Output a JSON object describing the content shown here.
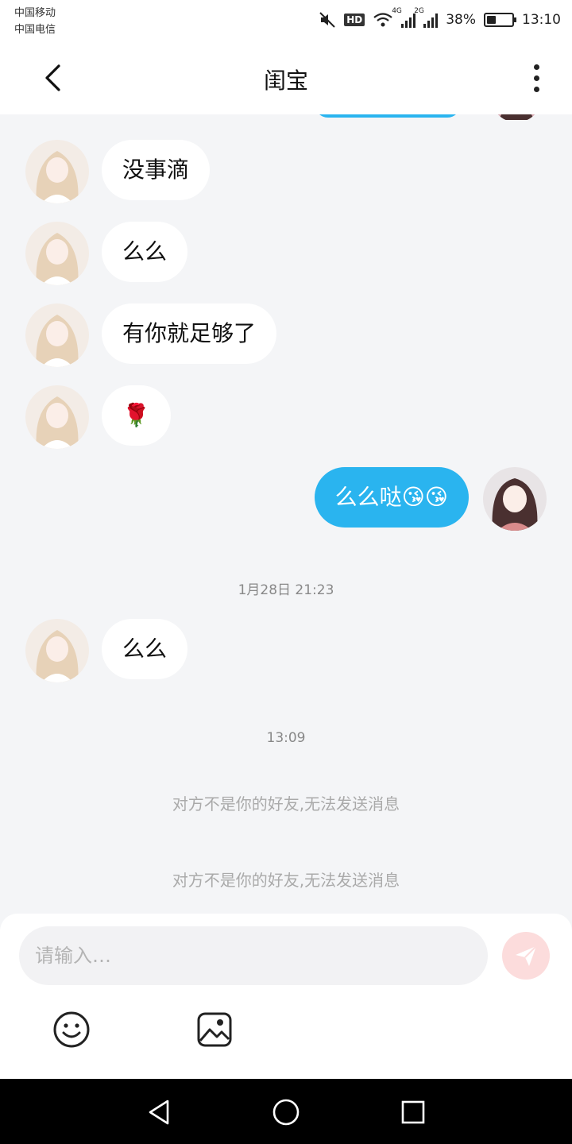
{
  "status_bar": {
    "carrier1": "中国移动",
    "carrier2": "中国电信",
    "hd": "HD",
    "net1": "4G",
    "net2": "2G",
    "battery": "38%",
    "battery_level": 0.38,
    "time": "13:10"
  },
  "header": {
    "title": "闺宝"
  },
  "messages": [
    {
      "side": "in",
      "text": "没事滴"
    },
    {
      "side": "in",
      "text": "么么"
    },
    {
      "side": "in",
      "text": "有你就足够了"
    },
    {
      "side": "in",
      "text": "🌹"
    },
    {
      "side": "out",
      "text": "么么哒😘😘"
    }
  ],
  "timestamp1": "1月28日 21:23",
  "messages2": [
    {
      "side": "in",
      "text": "么么"
    }
  ],
  "timestamp2": "13:09",
  "system_notices": [
    "对方不是你的好友,无法发送消息",
    "对方不是你的好友,无法发送消息"
  ],
  "composer": {
    "placeholder": "请输入…"
  },
  "colors": {
    "accent": "#2ab4ef",
    "background": "#f4f5f7",
    "send_button": "#fcdcdc"
  },
  "icons": {
    "back": "chevron-left-icon",
    "more": "more-vertical-icon",
    "send": "paper-plane-icon",
    "emoji": "smiley-icon",
    "image": "image-icon"
  }
}
